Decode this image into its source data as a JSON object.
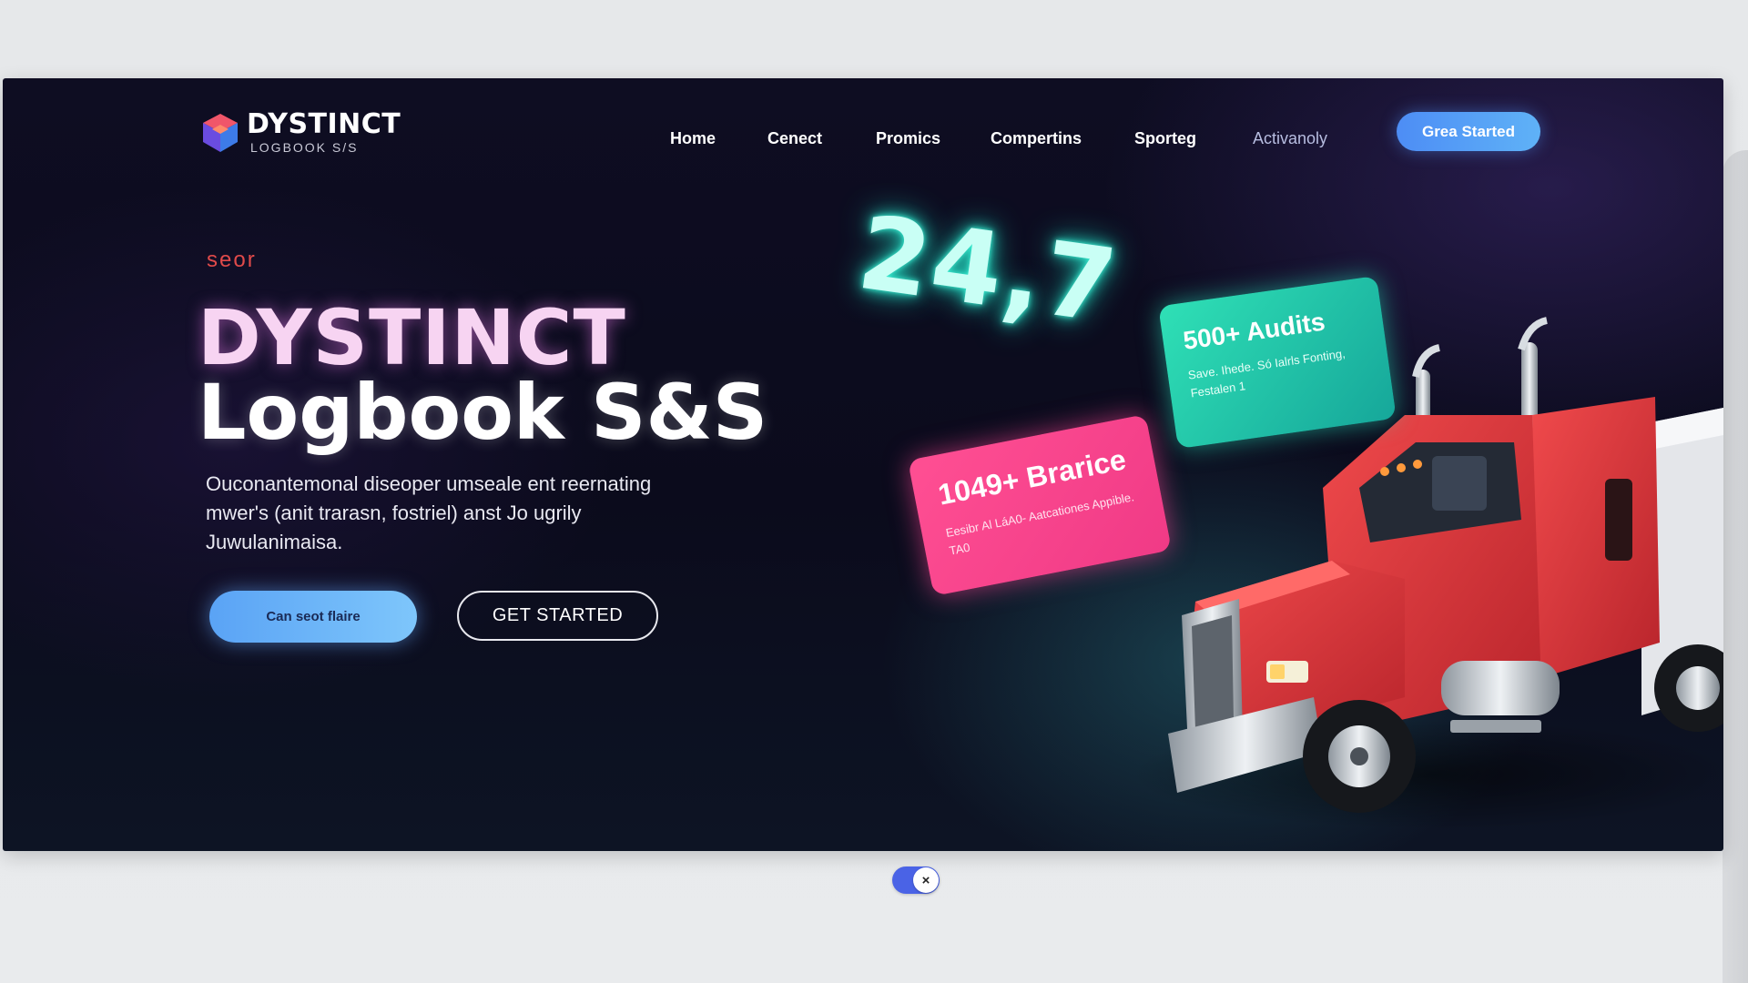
{
  "brand": {
    "title": "DYSTINCT",
    "subtitle": "LOGBOOK S/S"
  },
  "nav": {
    "items": [
      {
        "label": "Home"
      },
      {
        "label": "Cenect"
      },
      {
        "label": "Promics"
      },
      {
        "label": "Compertins"
      },
      {
        "label": "Sporteg"
      },
      {
        "label": "Activanoly"
      }
    ],
    "cta": "Grea Started"
  },
  "hero": {
    "eyebrow": "seor",
    "title_line1": "DYSTINCT",
    "title_line2": "Logbook  S&S",
    "description": "Ouconantemonal diseoper umseale ent reernating mwer's (anit trarasn, fostriel) anst Jo ugrily Juwulanimaisa.",
    "primary_button": "Can seot flaire",
    "secondary_button": "GET STARTED"
  },
  "neon_badge": "24,7",
  "cards": {
    "green": {
      "title": "500+ Audits",
      "text": "Save. Ihede. Só Ialrls Fonting, Festalen 1"
    },
    "pink": {
      "title": "1049+ Brarice",
      "text": "Eesibr Al LáA0- Aatcationes Appible. TA0"
    }
  },
  "toggle": {
    "state": "on",
    "close_glyph": "×"
  },
  "colors": {
    "accent_blue": "#4d8df5",
    "neon_green": "#2fe0b6",
    "neon_pink": "#ff4f93",
    "truck_red": "#d9353a",
    "eyebrow_red": "#e04a4a"
  }
}
